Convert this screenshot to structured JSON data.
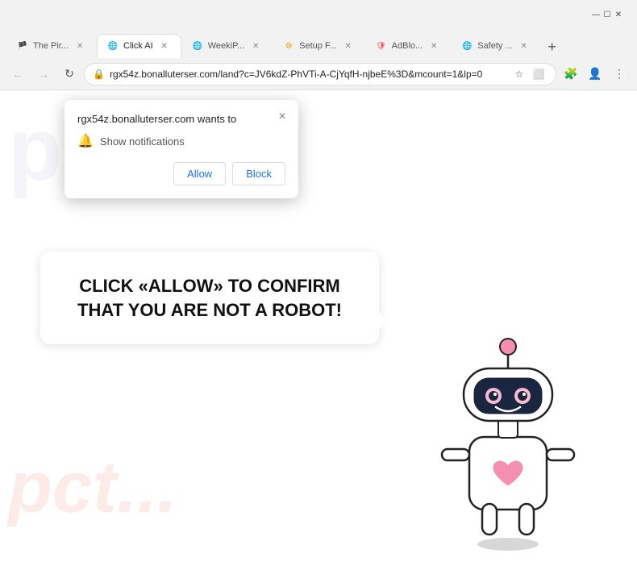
{
  "browser": {
    "tabs": [
      {
        "id": "tab-pirate",
        "label": "The Pir...",
        "favicon": "🏴",
        "active": false,
        "closeable": true
      },
      {
        "id": "tab-clickai",
        "label": "Click AI",
        "favicon": "🌐",
        "active": true,
        "closeable": true
      },
      {
        "id": "tab-weekly",
        "label": "WeekiP...",
        "favicon": "🌐",
        "active": false,
        "closeable": true
      },
      {
        "id": "tab-setup",
        "label": "Setup F...",
        "favicon": "⚙",
        "active": false,
        "closeable": true
      },
      {
        "id": "tab-adblock",
        "label": "AdBlo...",
        "favicon": "🛡",
        "active": false,
        "closeable": true
      },
      {
        "id": "tab-safety",
        "label": "Safety ...",
        "favicon": "🌐",
        "active": false,
        "closeable": true
      }
    ],
    "new_tab_label": "+",
    "address_bar": {
      "url": "rgx54z.bonalluterser.com/land?c=JV6kdZ-PhVTi-A-CjYqfH-njbeE%3D&mcount=1&lp=0",
      "lock_icon": "🔒"
    },
    "toolbar_buttons": {
      "back": "←",
      "forward": "→",
      "refresh": "↻",
      "bookmark": "☆",
      "extensions": "🧩",
      "profile": "👤",
      "menu": "⋮",
      "cast": "⬜"
    }
  },
  "notification_popup": {
    "site": "rgx54z.bonalluterser.com wants to",
    "permission": "Show notifications",
    "allow_label": "Allow",
    "block_label": "Block",
    "close_icon": "✕"
  },
  "page": {
    "message": "CLICK «ALLOW» TO CONFIRM THAT YOU ARE NOT A ROBOT!",
    "watermark1": "pct...",
    "watermark2": "pct..."
  }
}
